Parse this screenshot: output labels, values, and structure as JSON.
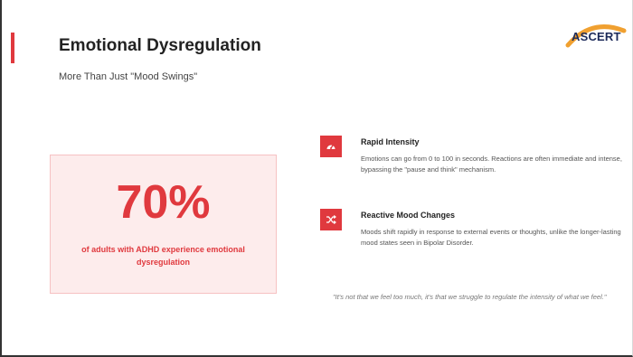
{
  "slide": {
    "title": "Emotional Dysregulation",
    "subtitle": "More Than Just \"Mood Swings\"",
    "logo_text": "ASCERT"
  },
  "stat": {
    "value": "70%",
    "description": "of adults with ADHD experience emotional dysregulation"
  },
  "items": [
    {
      "icon": "speedometer-icon",
      "title": "Rapid Intensity",
      "text": "Emotions can go from 0 to 100 in seconds. Reactions are often immediate and intense, bypassing the \"pause and think\" mechanism."
    },
    {
      "icon": "shuffle-icon",
      "title": "Reactive Mood Changes",
      "text": "Moods shift rapidly in response to external events or thoughts, unlike the longer-lasting mood states seen in Bipolar Disorder."
    }
  ],
  "quote": "\"It's not that we feel too much, it's that we struggle to regulate the intensity of what we feel.\"",
  "colors": {
    "accent": "#e0393e",
    "stat_bg": "#fdecec",
    "logo_orange": "#f0a030",
    "logo_navy": "#1c2a5a"
  }
}
